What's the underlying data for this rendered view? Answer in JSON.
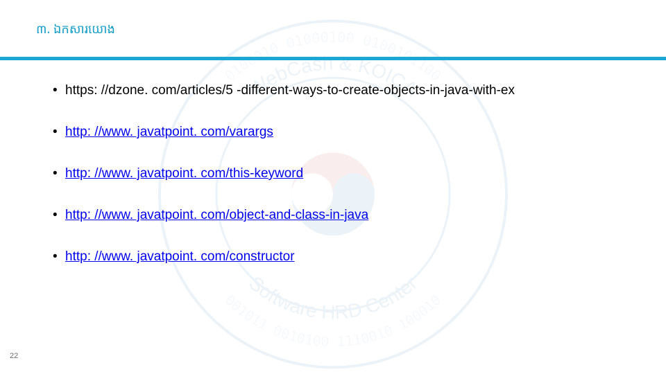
{
  "heading": "៣. ឯកសារយោង",
  "links": [
    {
      "text": "https: //dzone. com/articles/5 -different-ways-to-create-objects-in-java-with-ex",
      "is_link_styled": false
    },
    {
      "text": "http: //www. javatpoint. com/varargs",
      "is_link_styled": true
    },
    {
      "text": "http: //www. javatpoint. com/this-keyword",
      "is_link_styled": true
    },
    {
      "text": "http: //www. javatpoint. com/object-and-class-in-java",
      "is_link_styled": true
    },
    {
      "text": "http: //www. javatpoint. com/constructor",
      "is_link_styled": true
    }
  ],
  "page_number": "22"
}
